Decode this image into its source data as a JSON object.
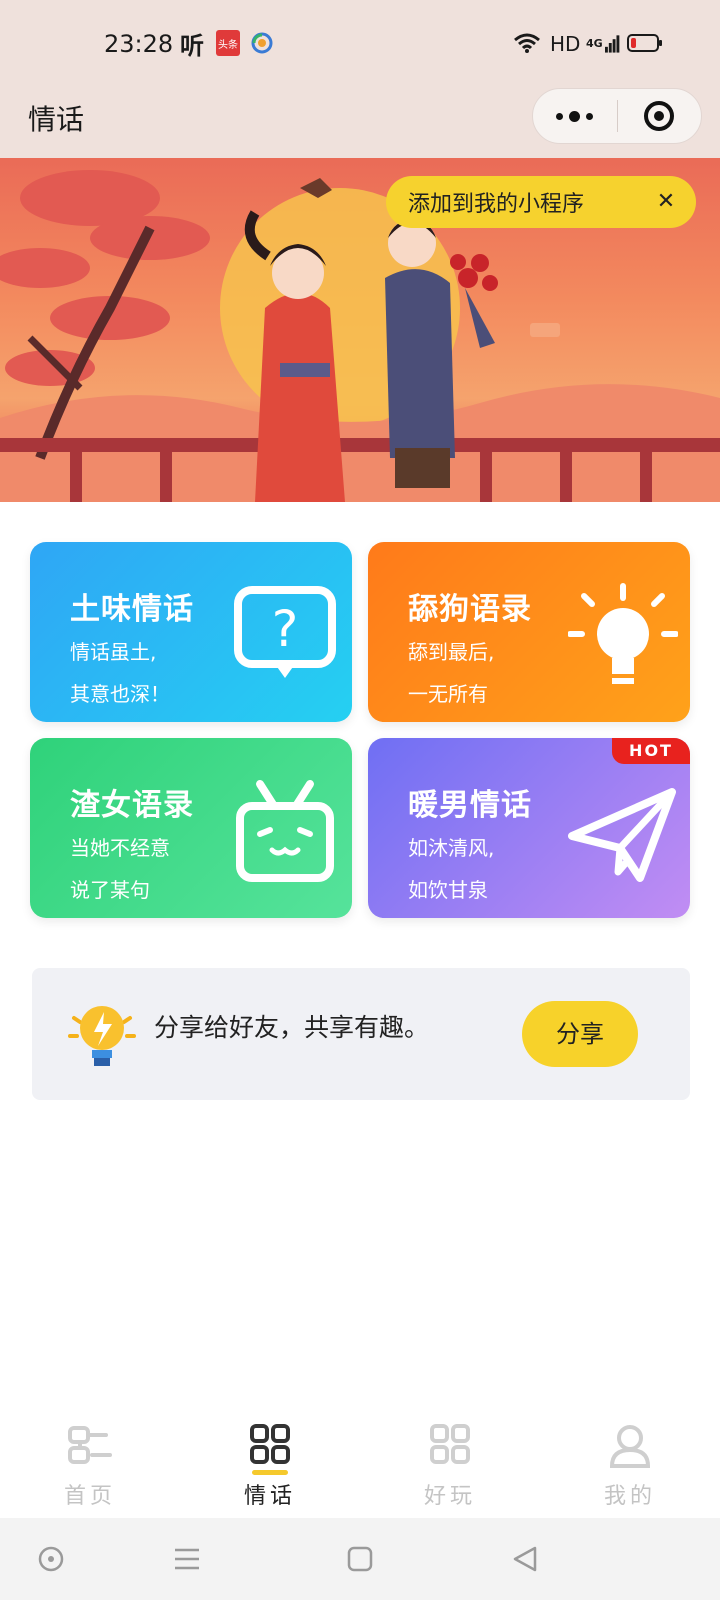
{
  "status_bar": {
    "time": "23:28",
    "app_icon_1": "听",
    "app_icon_2": "头条",
    "network": "HD",
    "network_gen": "4G",
    "icons": [
      "wifi-icon",
      "signal-icon",
      "battery-low-icon"
    ]
  },
  "header": {
    "title": "情话",
    "capsule": {
      "more_icon": "more-dots-icon",
      "close_icon": "target-circle-icon"
    }
  },
  "banner": {
    "add_tip": "添加到我的小程序",
    "close_tip_icon": "close-icon"
  },
  "cards": [
    {
      "title": "土味情话",
      "line1": "情话虽土,",
      "line2": "其意也深！",
      "icon": "question-bubble-icon",
      "hot": ""
    },
    {
      "title": "舔狗语录",
      "line1": "舔到最后,",
      "line2": "一无所有",
      "icon": "lightbulb-icon",
      "hot": ""
    },
    {
      "title": "渣女语录",
      "line1": "当她不经意",
      "line2": "说了某句",
      "icon": "tv-face-icon",
      "hot": ""
    },
    {
      "title": "暖男情话",
      "line1": "如沐清风,",
      "line2": "如饮甘泉",
      "icon": "paper-plane-icon",
      "hot": "HOT"
    }
  ],
  "share": {
    "text": "分享给好友，共享有趣。",
    "button": "分享",
    "icon": "bulb-lightning-icon"
  },
  "tabbar": {
    "tabs": [
      {
        "label": "首页",
        "icon": "link-icon",
        "active": false
      },
      {
        "label": "情话",
        "icon": "grid-icon",
        "active": true
      },
      {
        "label": "好玩",
        "icon": "grid-icon",
        "active": false
      },
      {
        "label": "我的",
        "icon": "user-icon",
        "active": false
      }
    ]
  },
  "system_nav": {
    "buttons": [
      "assistant-circle-icon",
      "menu-icon",
      "home-square-icon",
      "back-triangle-icon"
    ]
  },
  "colors": {
    "header_bg": "#efe1dc",
    "accent_yellow": "#f7d22a",
    "card_blue": "#2fa6f5",
    "card_orange": "#ff7a1a",
    "card_green": "#2fd27a",
    "card_purple": "#6f6ff3",
    "hot_red": "#e8221e"
  }
}
